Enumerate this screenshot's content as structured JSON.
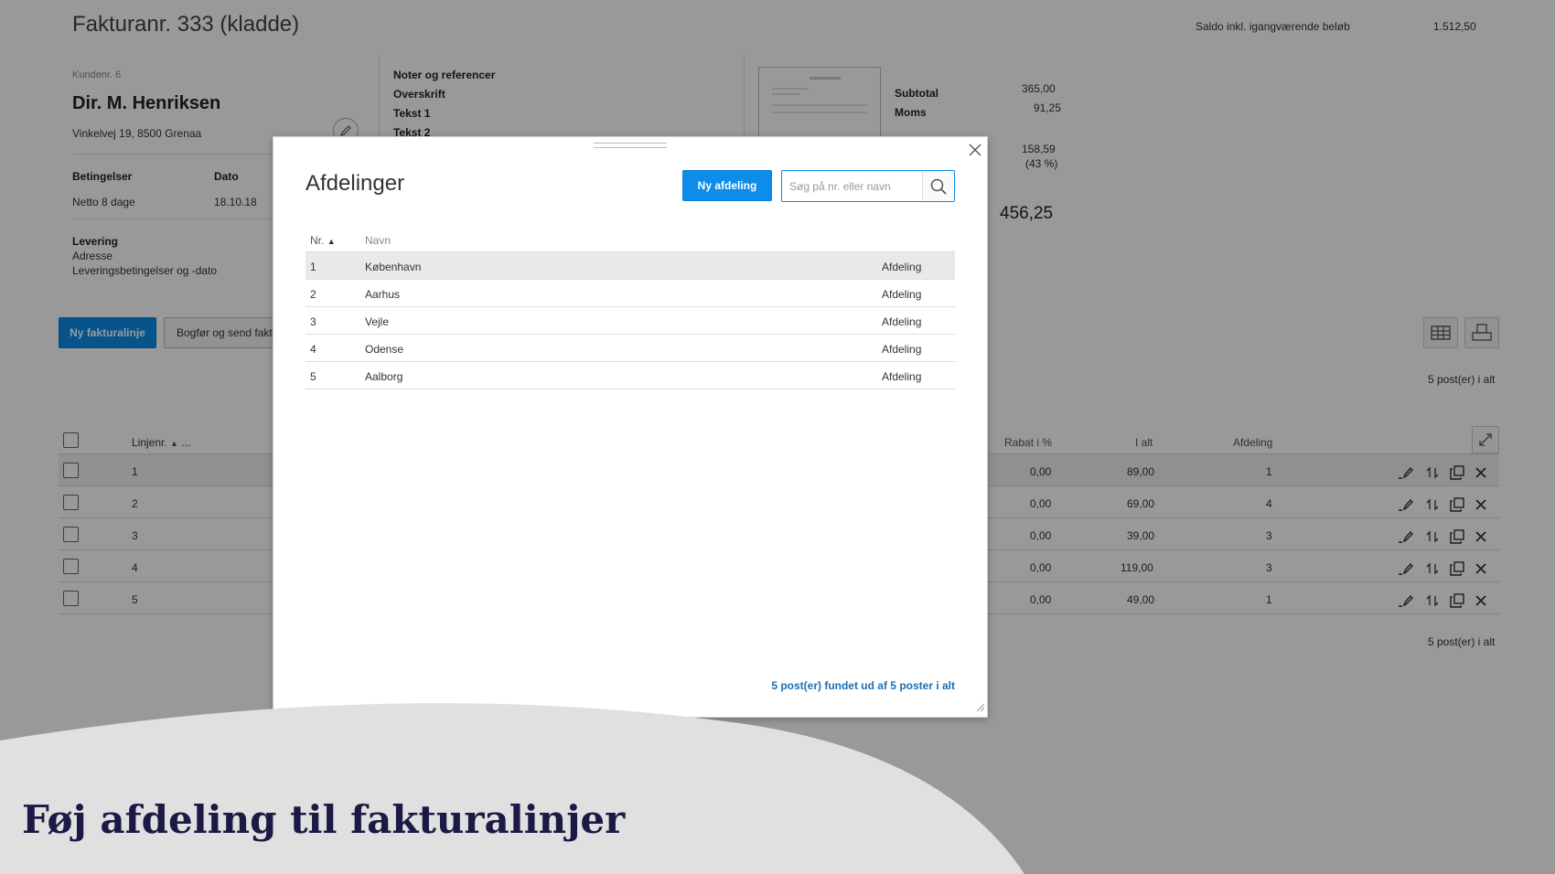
{
  "invoice": {
    "title": "Fakturanr. 333 (kladde)",
    "balance_label": "Saldo inkl. igangværende beløb",
    "balance_value": "1.512,50",
    "customer_no": "Kundenr. 6",
    "customer_name": "Dir. M. Henriksen",
    "customer_address": "Vinkelvej 19, 8500 Grenaa",
    "terms_label": "Betingelser",
    "terms_value": "Netto 8 dage",
    "date_label": "Dato",
    "date_value": "18.10.18",
    "delivery_label": "Levering",
    "delivery_address": "Adresse",
    "delivery_terms": "Leveringsbetingelser og -dato",
    "notes": [
      "Noter og referencer",
      "Overskrift",
      "Tekst 1",
      "Tekst 2"
    ],
    "subtotal_label": "Subtotal",
    "subtotal_value": "365,00",
    "vat_label": "Moms",
    "vat_value": "91,25",
    "margin_value": "158,59",
    "margin_pct": "(43 %)",
    "total_value": "456,25",
    "new_line_label": "Ny fakturalinje",
    "book_send_label": "Bogfør og send faktura",
    "count_top": "5 post(er) i alt",
    "count_bottom": "5 post(er) i alt"
  },
  "lines_table": {
    "headers": {
      "line_no": "Linjenr.",
      "more": "...",
      "discount": "Rabat i %",
      "total": "I alt",
      "department": "Afdeling"
    },
    "rows": [
      {
        "line": "1",
        "discount": "0,00",
        "total": "89,00",
        "department": "1"
      },
      {
        "line": "2",
        "discount": "0,00",
        "total": "69,00",
        "department": "4"
      },
      {
        "line": "3",
        "discount": "0,00",
        "total": "39,00",
        "department": "3"
      },
      {
        "line": "4",
        "discount": "0,00",
        "total": "119,00",
        "department": "3"
      },
      {
        "line": "5",
        "discount": "0,00",
        "total": "49,00",
        "department": "1"
      }
    ]
  },
  "modal": {
    "title": "Afdelinger",
    "new_button": "Ny afdeling",
    "search_placeholder": "Søg på nr. eller navn",
    "col_nr": "Nr.",
    "col_name": "Navn",
    "rows": [
      {
        "nr": "1",
        "name": "København",
        "type": "Afdeling"
      },
      {
        "nr": "2",
        "name": "Aarhus",
        "type": "Afdeling"
      },
      {
        "nr": "3",
        "name": "Vejle",
        "type": "Afdeling"
      },
      {
        "nr": "4",
        "name": "Odense",
        "type": "Afdeling"
      },
      {
        "nr": "5",
        "name": "Aalborg",
        "type": "Afdeling"
      }
    ],
    "footer": "5 post(er) fundet ud af 5 poster i alt"
  },
  "banner": {
    "text": "Føj afdeling til fakturalinjer"
  },
  "colors": {
    "accent": "#0d8ce9",
    "banner_bg": "#e1e0e0",
    "banner_text": "#1b1a45",
    "link": "#1b6fb5"
  }
}
